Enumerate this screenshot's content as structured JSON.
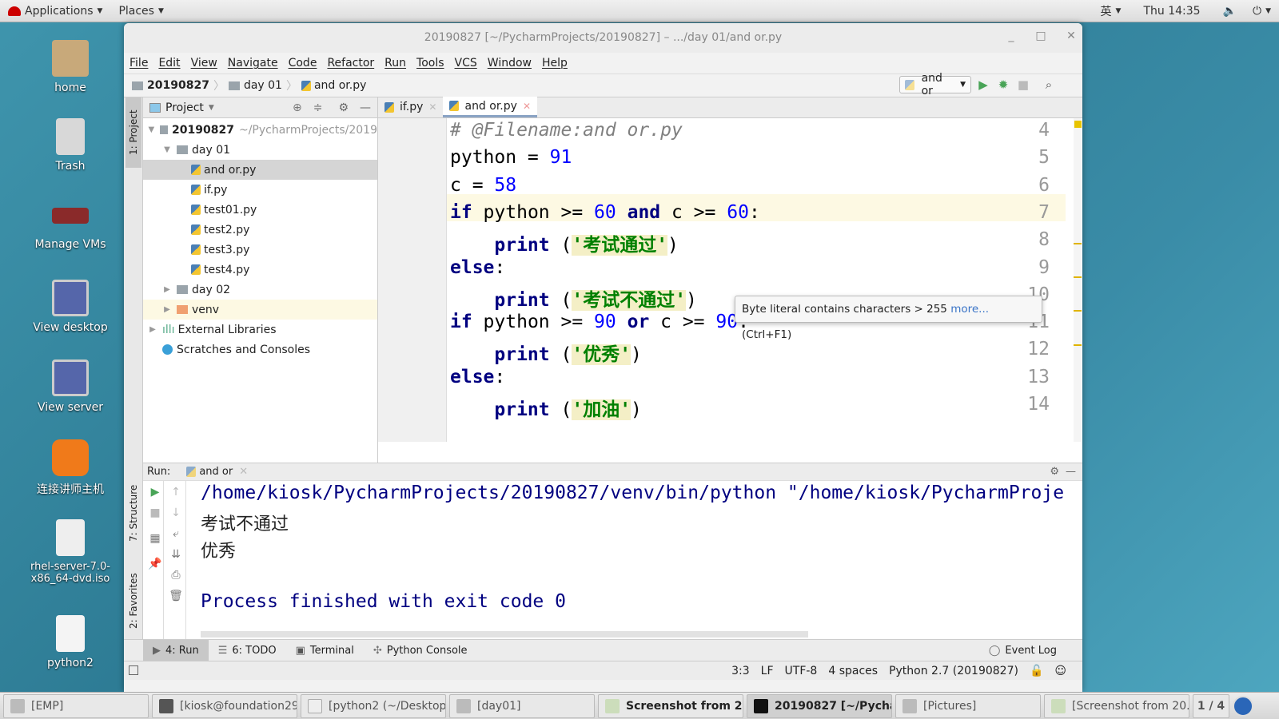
{
  "top_panel": {
    "applications": "Applications",
    "places": "Places",
    "input_method": "英",
    "clock": "Thu 14:35"
  },
  "desktop": {
    "icons": [
      {
        "label": "home"
      },
      {
        "label": "Trash"
      },
      {
        "label": "Manage VMs"
      },
      {
        "label": "View desktop"
      },
      {
        "label": "View server"
      },
      {
        "label": "连接讲师主机"
      },
      {
        "label": "rhel-server-7.0-x86_64-dvd.iso"
      },
      {
        "label": "python2"
      }
    ]
  },
  "window": {
    "title": "20190827 [~/PycharmProjects/20190827] – .../day 01/and or.py"
  },
  "menu": [
    "File",
    "Edit",
    "View",
    "Navigate",
    "Code",
    "Refactor",
    "Run",
    "Tools",
    "VCS",
    "Window",
    "Help"
  ],
  "breadcrumb": [
    "20190827",
    "day 01",
    "and or.py"
  ],
  "toolbar": {
    "run_config": "and or"
  },
  "side_tabs": {
    "project": "1: Project",
    "structure": "7: Structure",
    "favorites": "2: Favorites"
  },
  "project": {
    "header": "Project",
    "root": "20190827",
    "root_path": "~/PycharmProjects/2019",
    "items": [
      {
        "label": "day 01"
      },
      {
        "label": "and or.py"
      },
      {
        "label": "if.py"
      },
      {
        "label": "test01.py"
      },
      {
        "label": "test2.py"
      },
      {
        "label": "test3.py"
      },
      {
        "label": "test4.py"
      },
      {
        "label": "day 02"
      },
      {
        "label": "venv"
      },
      {
        "label": "External Libraries"
      },
      {
        "label": "Scratches and Consoles"
      }
    ]
  },
  "editor": {
    "tabs": [
      "if.py",
      "and or.py"
    ],
    "line_numbers": [
      "4",
      "5",
      "6",
      "7",
      "8",
      "9",
      "10",
      "11",
      "12",
      "13",
      "14"
    ],
    "tooltip": {
      "text": "Byte literal contains characters > 255",
      "link": "more...",
      "shortcut": "(Ctrl+F1)"
    }
  },
  "run": {
    "label": "Run:",
    "config": "and or",
    "output": [
      "/home/kiosk/PycharmProjects/20190827/venv/bin/python \"/home/kiosk/PycharmProje",
      "考试不通过",
      "优秀",
      "",
      "Process finished with exit code 0"
    ]
  },
  "bottom_tabs": [
    {
      "label": "4: Run"
    },
    {
      "label": "6: TODO"
    },
    {
      "label": "Terminal"
    },
    {
      "label": "Python Console"
    }
  ],
  "event_log": "Event Log",
  "status": {
    "position": "3:3",
    "line_sep": "LF",
    "encoding": "UTF-8",
    "indent": "4 spaces",
    "interpreter": "Python 2.7 (20190827)"
  },
  "taskbar": [
    {
      "label": "[EMP]"
    },
    {
      "label": "[kiosk@foundation29..."
    },
    {
      "label": "[python2 (~/Desktop)..."
    },
    {
      "label": "[day01]"
    },
    {
      "label": "Screenshot from 201..."
    },
    {
      "label": "20190827 [~/Pycha..."
    },
    {
      "label": "[Pictures]"
    },
    {
      "label": "[Screenshot from 20..."
    }
  ],
  "workspace": "1 / 4"
}
